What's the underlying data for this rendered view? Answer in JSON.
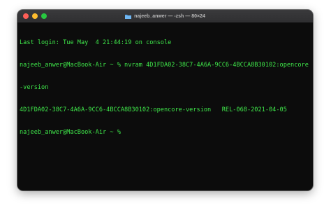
{
  "window": {
    "title": "najeeb_anwer — -zsh — 80×24"
  },
  "colors": {
    "text": "#3fe84a",
    "background": "#0c0c0c",
    "close": "#ff5f57",
    "minimize": "#febc2e",
    "zoom": "#28c840"
  },
  "terminal": {
    "lines": [
      "Last login: Tue May  4 21:44:19 on console",
      "najeeb_anwer@MacBook-Air ~ % nvram 4D1FDA02-38C7-4A6A-9CC6-4BCCA8B30102:opencore",
      "-version",
      "4D1FDA02-38C7-4A6A-9CC6-4BCCA8B30102:opencore-version   REL-068-2021-04-05",
      "najeeb_anwer@MacBook-Air ~ % "
    ]
  }
}
